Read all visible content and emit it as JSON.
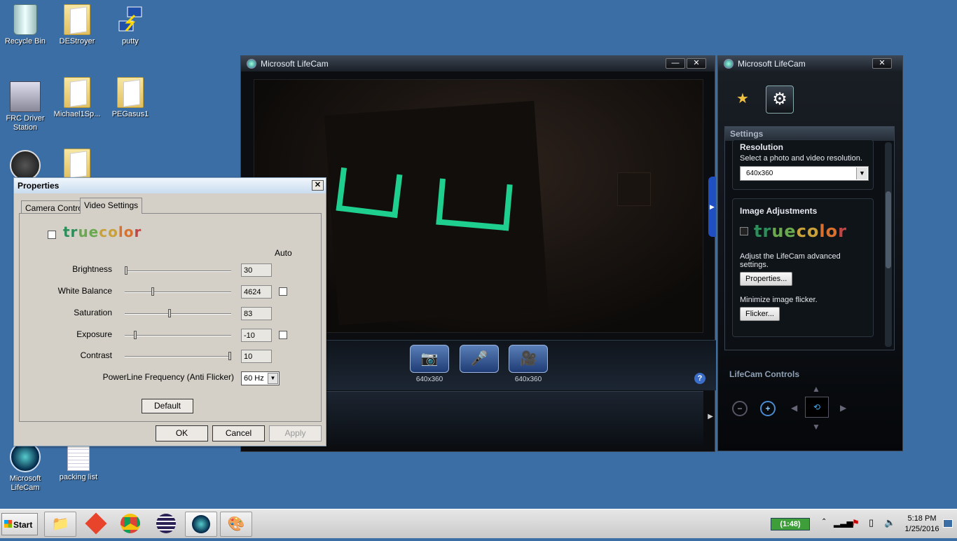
{
  "desktop": {
    "icons": [
      {
        "label": "Recycle Bin"
      },
      {
        "label": "DEStroyer"
      },
      {
        "label": "putty"
      },
      {
        "label": "FRC Driver Station"
      },
      {
        "label": "Michael1Sp..."
      },
      {
        "label": "PEGasus1"
      },
      {
        "label": "Microsoft LifeCam"
      },
      {
        "label": "packing list"
      }
    ]
  },
  "lifecam_main": {
    "title": "Microsoft LifeCam",
    "minimize": "—",
    "close": "✕",
    "capture_buttons": [
      {
        "icon": "camera-icon",
        "label": "640x360"
      },
      {
        "icon": "microphone-icon",
        "label": ""
      },
      {
        "icon": "video-camera-icon",
        "label": "640x360"
      }
    ],
    "help": "?"
  },
  "lifecam_side": {
    "title": "Microsoft LifeCam",
    "close": "✕",
    "settings_header": "Settings",
    "resolution": {
      "title": "Resolution",
      "desc": "Select a photo and video resolution.",
      "selected": "640x360"
    },
    "image_adjustments": {
      "title": "Image Adjustments",
      "truecolor_letters": [
        "tr",
        "ue",
        "co",
        "lo",
        "r"
      ],
      "advanced_text": "Adjust the LifeCam advanced settings.",
      "properties_button": "Properties...",
      "flicker_text": "Minimize image flicker.",
      "flicker_button": "Flicker..."
    },
    "controls_header": "LifeCam Controls"
  },
  "properties_dialog": {
    "title": "Properties",
    "close": "✕",
    "tabs": [
      "Camera Control",
      "Video Settings"
    ],
    "active_tab": "Video Settings",
    "auto_label": "Auto",
    "truecolor_letters": [
      "tr",
      "ue",
      "co",
      "lo",
      "r"
    ],
    "sliders": [
      {
        "label": "Brightness",
        "value": "30",
        "fraction": 0.0,
        "auto": false
      },
      {
        "label": "White Balance",
        "value": "4624",
        "fraction": 0.26,
        "auto": true
      },
      {
        "label": "Saturation",
        "value": "83",
        "fraction": 0.42,
        "auto": false
      },
      {
        "label": "Exposure",
        "value": "-10",
        "fraction": 0.09,
        "auto": true
      },
      {
        "label": "Contrast",
        "value": "10",
        "fraction": 1.0,
        "auto": false
      }
    ],
    "powerline_label": "PowerLine Frequency (Anti Flicker)",
    "powerline_value": "60 Hz",
    "default_button": "Default",
    "ok_button": "OK",
    "cancel_button": "Cancel",
    "apply_button": "Apply"
  },
  "taskbar": {
    "start_label": "Start",
    "battery": "(1:48)",
    "time": "5:18 PM",
    "date": "1/25/2016"
  }
}
